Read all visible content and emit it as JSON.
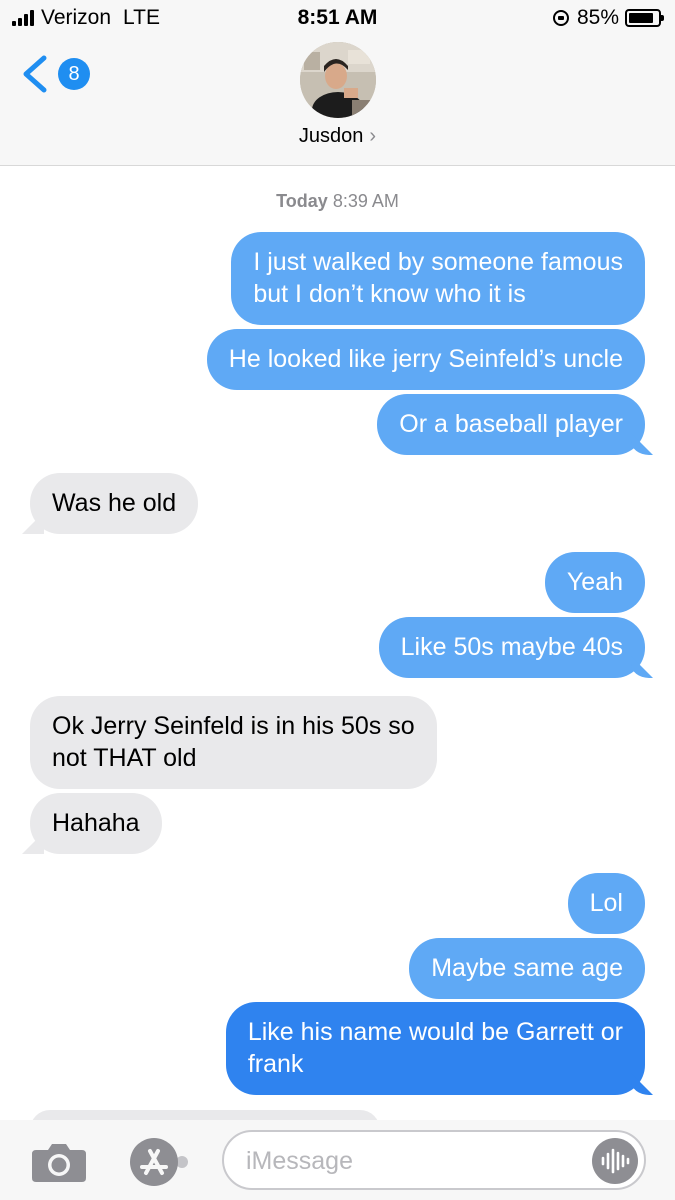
{
  "status_bar": {
    "carrier": "Verizon",
    "network": "LTE",
    "time": "8:51 AM",
    "battery_text": "85%",
    "battery_level": 0.85
  },
  "header": {
    "back_badge_count": "8",
    "contact_name": "Jusdon",
    "contact_chevron": "›"
  },
  "timestamp": {
    "day": "Today",
    "time": "8:39 AM"
  },
  "messages": [
    {
      "from": "me",
      "text": "I just walked by someone famous\nbut I don’t know who it is"
    },
    {
      "from": "me",
      "text": "He looked like jerry Seinfeld’s uncle"
    },
    {
      "from": "me",
      "text": "Or a baseball player"
    },
    {
      "from": "them",
      "text": "Was he old"
    },
    {
      "from": "me",
      "text": "Yeah"
    },
    {
      "from": "me",
      "text": "Like 50s maybe 40s"
    },
    {
      "from": "them",
      "text": "Ok Jerry Seinfeld is in his 50s so\nnot THAT old"
    },
    {
      "from": "them",
      "text": "Hahaha"
    },
    {
      "from": "me",
      "text": "Lol"
    },
    {
      "from": "me",
      "text": "Maybe same age"
    },
    {
      "from": "me",
      "text": "Like his name would be Garrett or\nfrank"
    }
  ],
  "input_bar": {
    "placeholder": "iMessage",
    "icons": [
      "camera-icon",
      "app-store-icon",
      "audio-message-icon"
    ]
  },
  "colors": {
    "outgoing_bubble": "#5fa9f5",
    "outgoing_bubble_latest": "#2f83ef",
    "incoming_bubble": "#e9e9eb",
    "accent": "#1f8ef1"
  }
}
